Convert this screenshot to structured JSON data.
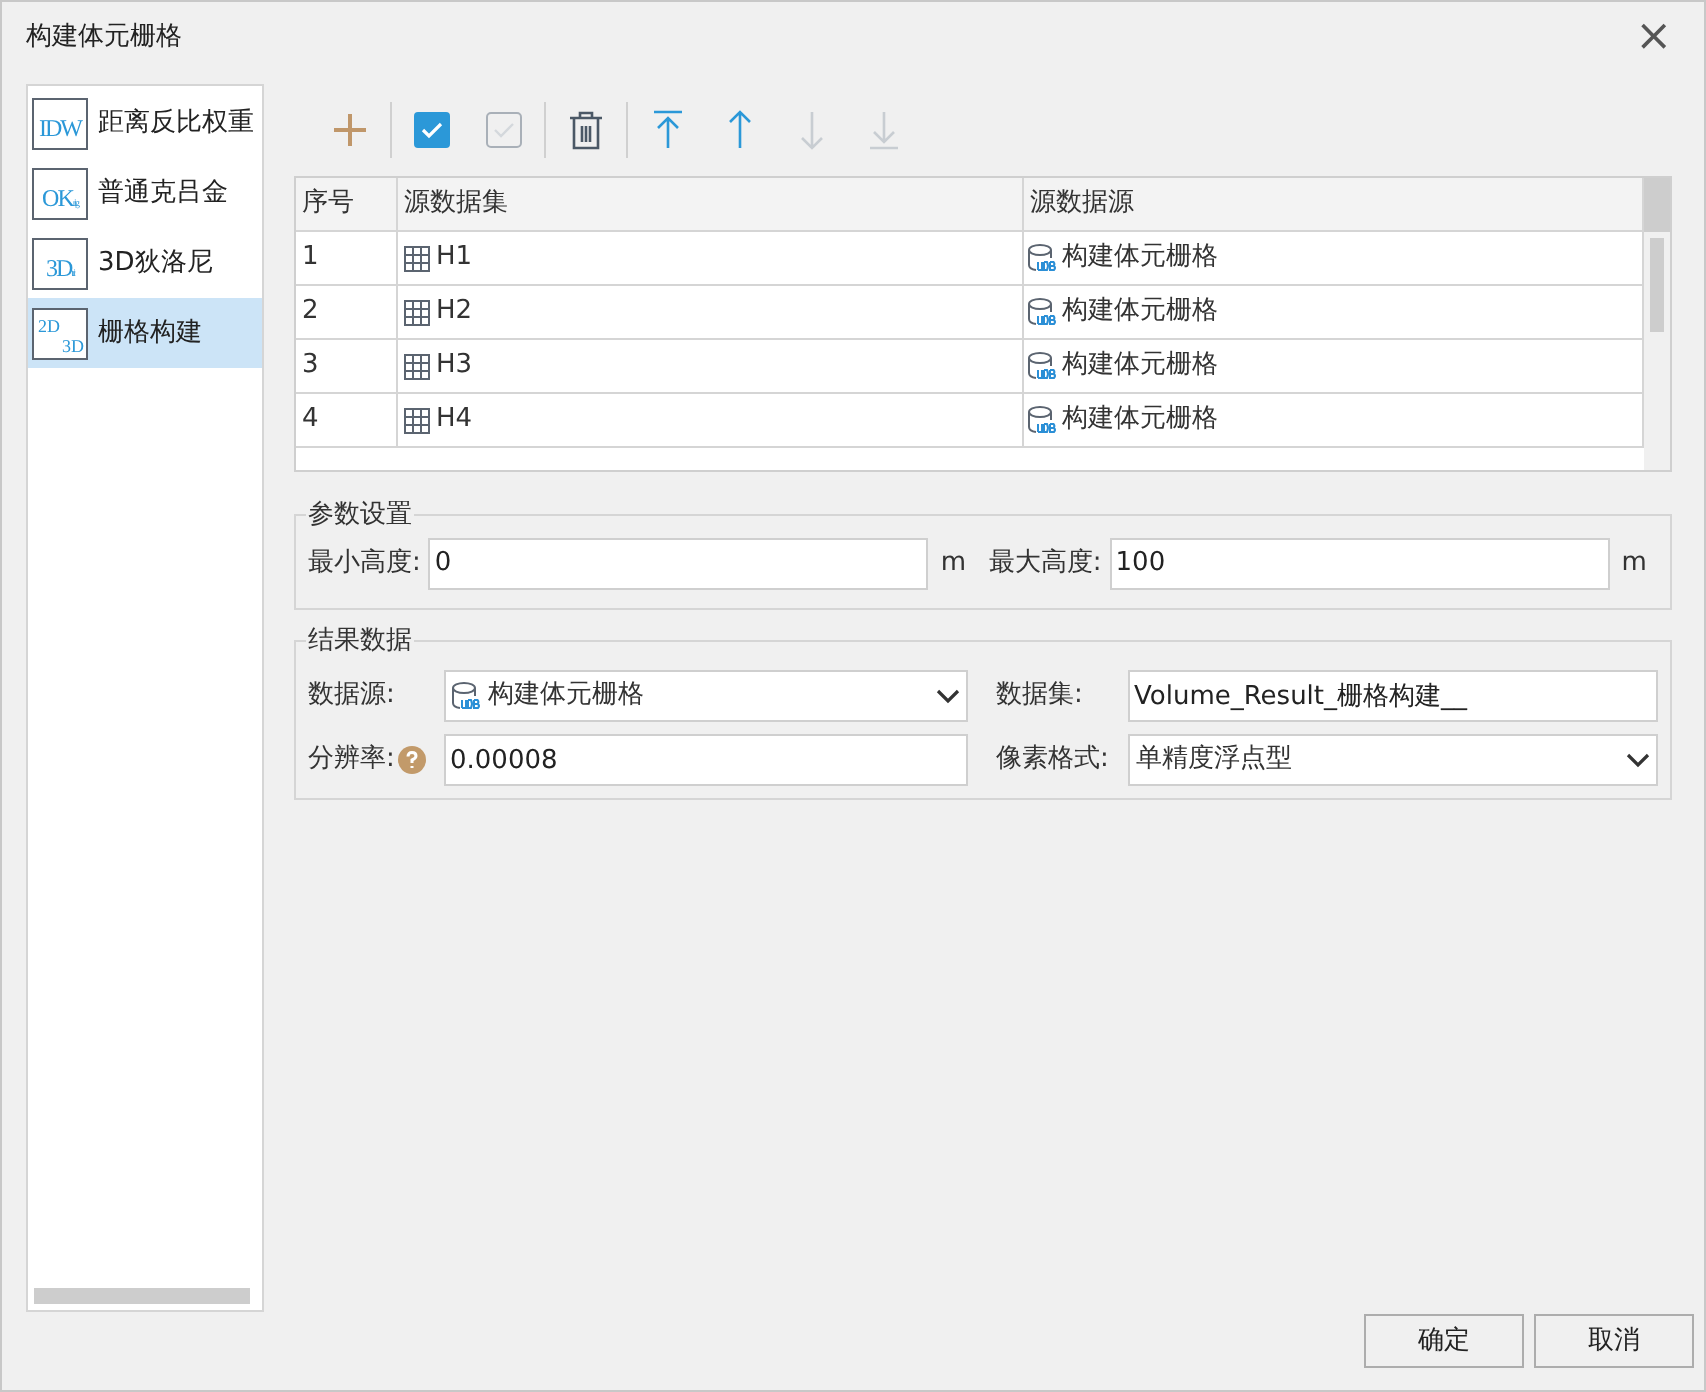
{
  "window": {
    "title": "构建体元栅格",
    "close": "×"
  },
  "sidebar": {
    "items": [
      {
        "kind": "plain",
        "logo": "IDW",
        "label": "距离反比权重",
        "selected": false
      },
      {
        "kind": "plain",
        "logo": "OK",
        "logo_sub": "rig",
        "label": "普通克吕金",
        "selected": false
      },
      {
        "kind": "plain",
        "logo": "3D",
        "logo_sub": "tri",
        "label": "3D狄洛尼",
        "selected": false
      },
      {
        "kind": "stacked",
        "logo": "2D",
        "logo_sub": "3D",
        "label": "栅格构建",
        "selected": true
      }
    ]
  },
  "toolbar": [
    {
      "kind": "add",
      "disabled": false
    },
    {
      "kind": "select_all",
      "disabled": false
    },
    {
      "kind": "select_none",
      "disabled": true
    },
    {
      "kind": "delete",
      "disabled": false
    },
    {
      "kind": "top",
      "disabled": false
    },
    {
      "kind": "up",
      "disabled": false
    },
    {
      "kind": "down",
      "disabled": true
    },
    {
      "kind": "bottom",
      "disabled": true
    }
  ],
  "table": {
    "columns": [
      "序号",
      "源数据集",
      "源数据源"
    ],
    "rows": [
      {
        "index": "1",
        "dataset": "H1",
        "datasource": "构建体元栅格"
      },
      {
        "index": "2",
        "dataset": "H2",
        "datasource": "构建体元栅格"
      },
      {
        "index": "3",
        "dataset": "H3",
        "datasource": "构建体元栅格"
      },
      {
        "index": "4",
        "dataset": "H4",
        "datasource": "构建体元栅格"
      }
    ]
  },
  "params": {
    "title": "参数设置",
    "min_label": "最小高度:",
    "min_value": "0",
    "min_unit": "m",
    "max_label": "最大高度:",
    "max_value": "100",
    "max_unit": "m"
  },
  "result": {
    "title": "结果数据",
    "datasource_label": "数据源:",
    "datasource_value": "构建体元栅格",
    "dataset_label": "数据集:",
    "dataset_value": "Volume_Result_栅格构建__",
    "resolution_label": "分辨率:",
    "resolution_value": "0.00008",
    "pixel_label": "像素格式:",
    "pixel_value": "单精度浮点型"
  },
  "buttons": [
    "确定",
    "取消"
  ]
}
